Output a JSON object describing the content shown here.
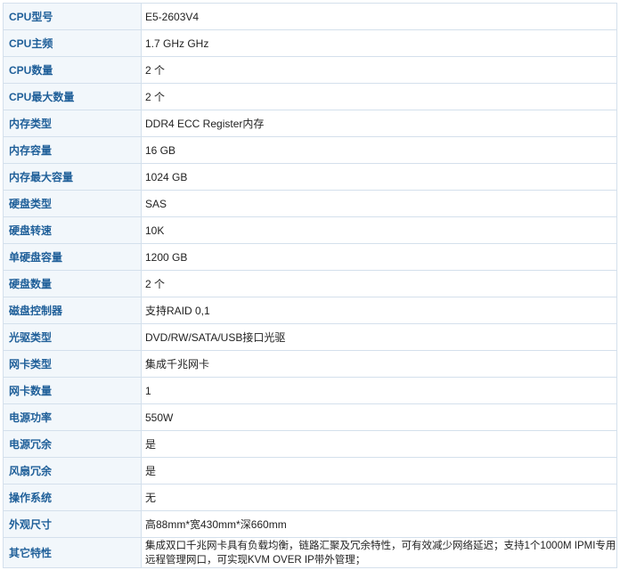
{
  "specs": [
    {
      "label": "CPU型号",
      "value": "E5-2603V4"
    },
    {
      "label": "CPU主频",
      "value": "1.7 GHz  GHz"
    },
    {
      "label": "CPU数量",
      "value": "2  个"
    },
    {
      "label": "CPU最大数量",
      "value": "2  个"
    },
    {
      "label": "内存类型",
      "value": "DDR4 ECC Register内存"
    },
    {
      "label": "内存容量",
      "value": "16  GB"
    },
    {
      "label": "内存最大容量",
      "value": "1024  GB"
    },
    {
      "label": "硬盘类型",
      "value": "SAS"
    },
    {
      "label": "硬盘转速",
      "value": "10K"
    },
    {
      "label": "单硬盘容量",
      "value": "1200  GB"
    },
    {
      "label": "硬盘数量",
      "value": "2  个"
    },
    {
      "label": "磁盘控制器",
      "value": "支持RAID 0,1"
    },
    {
      "label": "光驱类型",
      "value": "DVD/RW/SATA/USB接口光驱"
    },
    {
      "label": "网卡类型",
      "value": "集成千兆网卡"
    },
    {
      "label": "网卡数量",
      "value": "1"
    },
    {
      "label": "电源功率",
      "value": "550W"
    },
    {
      "label": "电源冗余",
      "value": "是"
    },
    {
      "label": "风扇冗余",
      "value": "是"
    },
    {
      "label": "操作系统",
      "value": "无"
    },
    {
      "label": "外观尺寸",
      "value": "高88mm*宽430mm*深660mm"
    },
    {
      "label": "其它特性",
      "value": "集成双口千兆网卡具有负载均衡，链路汇聚及冗余特性，可有效减少网络延迟；支持1个1000M IPMI专用远程管理网口，可实现KVM OVER IP带外管理；"
    }
  ]
}
